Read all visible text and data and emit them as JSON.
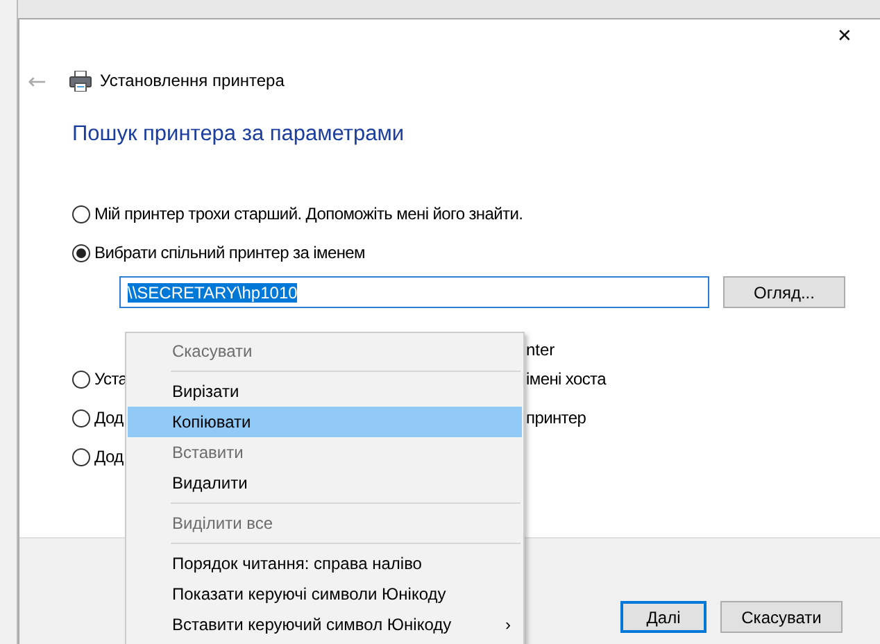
{
  "window": {
    "title": "Установлення принтера",
    "close": "✕",
    "back": "←"
  },
  "heading": "Пошук принтера за параметрами",
  "options": [
    {
      "left": "Мій принтер трохи старший. Допоможіть мені його знайти.",
      "selected": false
    },
    {
      "left": "Вибрати спільний принтер за іменем",
      "selected": true
    },
    {
      "left": "Уста",
      "right": "імені хоста",
      "selected": false
    },
    {
      "left": "Дод",
      "right": "принтер",
      "selected": false
    },
    {
      "left": "Дод",
      "selected": false
    }
  ],
  "share_field": {
    "value": "\\\\SECRETARY\\hp1010",
    "selected_all": true
  },
  "browse_button": "Огляд...",
  "hint_lines": [
    {
      "right": "nter"
    }
  ],
  "context_menu": [
    {
      "kind": "item",
      "label": "Скасувати",
      "disabled": true,
      "selected": false
    },
    {
      "kind": "separator"
    },
    {
      "kind": "item",
      "label": "Вирізати",
      "disabled": false,
      "selected": false
    },
    {
      "kind": "item",
      "label": "Копіювати",
      "disabled": false,
      "selected": true
    },
    {
      "kind": "item",
      "label": "Вставити",
      "disabled": true,
      "selected": false
    },
    {
      "kind": "item",
      "label": "Видалити",
      "disabled": false,
      "selected": false
    },
    {
      "kind": "separator"
    },
    {
      "kind": "item",
      "label": "Виділити все",
      "disabled": true,
      "selected": false
    },
    {
      "kind": "separator"
    },
    {
      "kind": "item",
      "label": "Порядок читання: справа наліво",
      "disabled": false,
      "selected": false
    },
    {
      "kind": "item",
      "label": "Показати керуючі символи Юнікоду",
      "disabled": false,
      "selected": false
    },
    {
      "kind": "item",
      "label": "Вставити керуючий символ Юнікоду",
      "disabled": false,
      "selected": false,
      "submenu": "›"
    }
  ],
  "buttons": [
    {
      "label": "Далі",
      "default": true
    },
    {
      "label": "Скасувати",
      "default": false
    }
  ]
}
